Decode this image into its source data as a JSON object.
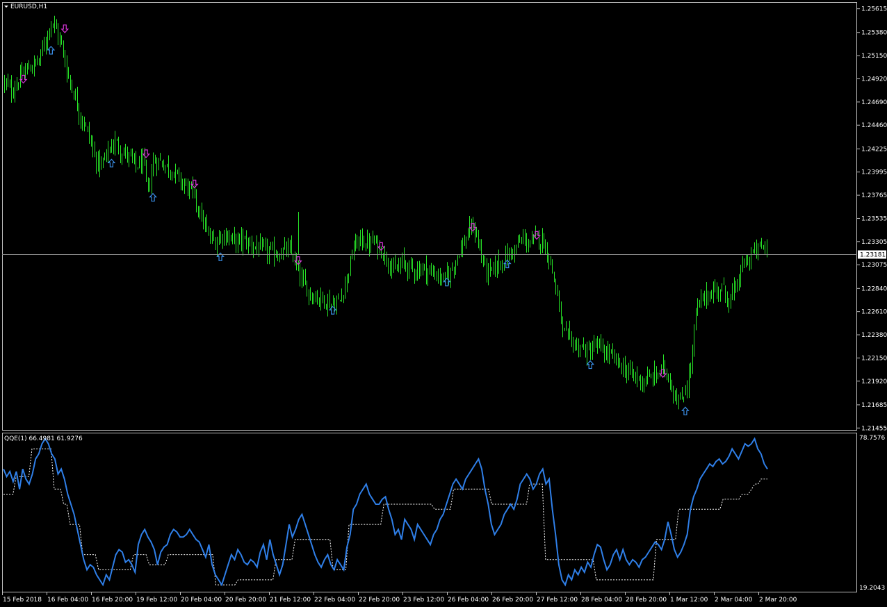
{
  "header": {
    "symbol_label": "EURUSD,H1"
  },
  "indicator": {
    "label": "QQE(1) 66.4981 61.9276"
  },
  "colors": {
    "background": "#000000",
    "frame": "#c0c0c0",
    "candle": "#27e327",
    "arrow_up": "#3a8ee6",
    "arrow_down": "#d633d6",
    "qqe_line": "#2f7fe8",
    "qqe_signal": "#ffffff",
    "price_line": "#8a8a8a",
    "price_badge": "#ffffff"
  },
  "chart_data": [
    {
      "type": "candlestick",
      "symbol": "EURUSD",
      "timeframe": "H1",
      "current_price": "1.23181",
      "y_ticks": [
        "1.25615",
        "1.25380",
        "1.25150",
        "1.24920",
        "1.24690",
        "1.24460",
        "1.24225",
        "1.23995",
        "1.23765",
        "1.23535",
        "1.23305",
        "1.23075",
        "1.22840",
        "1.22610",
        "1.22380",
        "1.22150",
        "1.21920",
        "1.21685",
        "1.21455"
      ],
      "x_ticks": [
        "15 Feb 2018",
        "16 Feb 04:00",
        "16 Feb 20:00",
        "19 Feb 12:00",
        "20 Feb 04:00",
        "20 Feb 20:00",
        "21 Feb 12:00",
        "22 Feb 04:00",
        "22 Feb 20:00",
        "23 Feb 12:00",
        "26 Feb 04:00",
        "26 Feb 20:00",
        "27 Feb 12:00",
        "28 Feb 04:00",
        "28 Feb 20:00",
        "1 Mar 12:00",
        "2 Mar 04:00",
        "2 Mar 20:00"
      ],
      "ylim": [
        1.2145,
        1.2564
      ],
      "close_path": [
        {
          "i": 0,
          "v": 1.2488
        },
        {
          "i": 4,
          "v": 1.248
        },
        {
          "i": 8,
          "v": 1.249
        },
        {
          "i": 12,
          "v": 1.25
        },
        {
          "i": 16,
          "v": 1.2505
        },
        {
          "i": 20,
          "v": 1.251
        },
        {
          "i": 24,
          "v": 1.2532
        },
        {
          "i": 27,
          "v": 1.255
        },
        {
          "i": 30,
          "v": 1.254
        },
        {
          "i": 33,
          "v": 1.2525
        },
        {
          "i": 36,
          "v": 1.25
        },
        {
          "i": 40,
          "v": 1.2478
        },
        {
          "i": 44,
          "v": 1.2455
        },
        {
          "i": 48,
          "v": 1.244
        },
        {
          "i": 52,
          "v": 1.2415
        },
        {
          "i": 56,
          "v": 1.2405
        },
        {
          "i": 60,
          "v": 1.242
        },
        {
          "i": 64,
          "v": 1.243
        },
        {
          "i": 68,
          "v": 1.242
        },
        {
          "i": 72,
          "v": 1.2415
        },
        {
          "i": 76,
          "v": 1.2405
        },
        {
          "i": 80,
          "v": 1.241
        },
        {
          "i": 83,
          "v": 1.238
        },
        {
          "i": 86,
          "v": 1.241
        },
        {
          "i": 90,
          "v": 1.241
        },
        {
          "i": 94,
          "v": 1.2405
        },
        {
          "i": 98,
          "v": 1.24
        },
        {
          "i": 102,
          "v": 1.239
        },
        {
          "i": 106,
          "v": 1.2385
        },
        {
          "i": 110,
          "v": 1.2375
        },
        {
          "i": 114,
          "v": 1.2355
        },
        {
          "i": 118,
          "v": 1.2335
        },
        {
          "i": 122,
          "v": 1.233
        },
        {
          "i": 126,
          "v": 1.2338
        },
        {
          "i": 130,
          "v": 1.2335
        },
        {
          "i": 134,
          "v": 1.233
        },
        {
          "i": 138,
          "v": 1.2332
        },
        {
          "i": 142,
          "v": 1.2328
        },
        {
          "i": 146,
          "v": 1.2325
        },
        {
          "i": 150,
          "v": 1.2322
        },
        {
          "i": 154,
          "v": 1.232
        },
        {
          "i": 158,
          "v": 1.2318
        },
        {
          "i": 162,
          "v": 1.2322
        },
        {
          "i": 166,
          "v": 1.232
        },
        {
          "i": 170,
          "v": 1.23
        },
        {
          "i": 174,
          "v": 1.2285
        },
        {
          "i": 178,
          "v": 1.2278
        },
        {
          "i": 182,
          "v": 1.2275
        },
        {
          "i": 186,
          "v": 1.2272
        },
        {
          "i": 190,
          "v": 1.2268
        },
        {
          "i": 194,
          "v": 1.2272
        },
        {
          "i": 198,
          "v": 1.2295
        },
        {
          "i": 202,
          "v": 1.2325
        },
        {
          "i": 206,
          "v": 1.2333
        },
        {
          "i": 210,
          "v": 1.2328
        },
        {
          "i": 214,
          "v": 1.233
        },
        {
          "i": 218,
          "v": 1.2322
        },
        {
          "i": 222,
          "v": 1.2312
        },
        {
          "i": 226,
          "v": 1.23
        },
        {
          "i": 230,
          "v": 1.231
        },
        {
          "i": 234,
          "v": 1.2305
        },
        {
          "i": 238,
          "v": 1.2302
        },
        {
          "i": 242,
          "v": 1.2305
        },
        {
          "i": 246,
          "v": 1.23
        },
        {
          "i": 250,
          "v": 1.2298
        },
        {
          "i": 254,
          "v": 1.2292
        },
        {
          "i": 258,
          "v": 1.23
        },
        {
          "i": 262,
          "v": 1.2318
        },
        {
          "i": 266,
          "v": 1.233
        },
        {
          "i": 270,
          "v": 1.2345
        },
        {
          "i": 273,
          "v": 1.2338
        },
        {
          "i": 276,
          "v": 1.2315
        },
        {
          "i": 280,
          "v": 1.2298
        },
        {
          "i": 284,
          "v": 1.2305
        },
        {
          "i": 288,
          "v": 1.2312
        },
        {
          "i": 292,
          "v": 1.2318
        },
        {
          "i": 296,
          "v": 1.2325
        },
        {
          "i": 300,
          "v": 1.2333
        },
        {
          "i": 304,
          "v": 1.2328
        },
        {
          "i": 308,
          "v": 1.2335
        },
        {
          "i": 312,
          "v": 1.233
        },
        {
          "i": 316,
          "v": 1.231
        },
        {
          "i": 320,
          "v": 1.2275
        },
        {
          "i": 323,
          "v": 1.224
        },
        {
          "i": 326,
          "v": 1.2235
        },
        {
          "i": 330,
          "v": 1.2228
        },
        {
          "i": 334,
          "v": 1.2225
        },
        {
          "i": 338,
          "v": 1.222
        },
        {
          "i": 342,
          "v": 1.2228
        },
        {
          "i": 346,
          "v": 1.2222
        },
        {
          "i": 350,
          "v": 1.2218
        },
        {
          "i": 354,
          "v": 1.2212
        },
        {
          "i": 358,
          "v": 1.2205
        },
        {
          "i": 362,
          "v": 1.22
        },
        {
          "i": 366,
          "v": 1.2195
        },
        {
          "i": 370,
          "v": 1.2192
        },
        {
          "i": 374,
          "v": 1.2195
        },
        {
          "i": 378,
          "v": 1.22
        },
        {
          "i": 382,
          "v": 1.2205
        },
        {
          "i": 385,
          "v": 1.2192
        },
        {
          "i": 388,
          "v": 1.2178
        },
        {
          "i": 391,
          "v": 1.217
        },
        {
          "i": 394,
          "v": 1.2185
        },
        {
          "i": 397,
          "v": 1.2205
        },
        {
          "i": 400,
          "v": 1.226
        },
        {
          "i": 403,
          "v": 1.2272
        },
        {
          "i": 407,
          "v": 1.2278
        },
        {
          "i": 411,
          "v": 1.2282
        },
        {
          "i": 415,
          "v": 1.2285
        },
        {
          "i": 419,
          "v": 1.2272
        },
        {
          "i": 423,
          "v": 1.2283
        },
        {
          "i": 427,
          "v": 1.2305
        },
        {
          "i": 431,
          "v": 1.2315
        },
        {
          "i": 435,
          "v": 1.2322
        },
        {
          "i": 439,
          "v": 1.2326
        },
        {
          "i": 441,
          "v": 1.2322
        }
      ],
      "bar_count": 442
    },
    {
      "type": "line",
      "name": "QQE(1)",
      "values_label": "66.4981 61.9276",
      "y_ticks": [
        "78.7576",
        "19.2043"
      ],
      "ylim": [
        19.2043,
        78.7576
      ],
      "series": [
        {
          "role": "qqe",
          "values": [
            66,
            63,
            65,
            61,
            65,
            58,
            66,
            62,
            60,
            64,
            70,
            72,
            76,
            78,
            76,
            72,
            70,
            64,
            66,
            62,
            56,
            52,
            48,
            42,
            36,
            30,
            26,
            28,
            27,
            24,
            22,
            20,
            24,
            22,
            27,
            32,
            34,
            33,
            29,
            30,
            28,
            25,
            36,
            40,
            42,
            39,
            37,
            34,
            28,
            33,
            35,
            36,
            40,
            42,
            41,
            39,
            39,
            40,
            42,
            40,
            38,
            37,
            34,
            31,
            36,
            28,
            24,
            22,
            20,
            24,
            28,
            32,
            30,
            34,
            32,
            29,
            28,
            30,
            29,
            27,
            33,
            36,
            30,
            38,
            32,
            28,
            24,
            28,
            36,
            44,
            39,
            42,
            46,
            48,
            44,
            40,
            36,
            32,
            29,
            27,
            30,
            32,
            28,
            26,
            30,
            28,
            26,
            35,
            40,
            50,
            52,
            56,
            58,
            60,
            56,
            54,
            52,
            52,
            54,
            55,
            50,
            46,
            40,
            42,
            38,
            46,
            44,
            42,
            38,
            44,
            42,
            40,
            38,
            36,
            40,
            42,
            46,
            48,
            52,
            56,
            60,
            62,
            60,
            58,
            62,
            64,
            66,
            68,
            70,
            66,
            58,
            52,
            44,
            40,
            42,
            44,
            48,
            50,
            52,
            50,
            54,
            60,
            62,
            64,
            62,
            58,
            60,
            64,
            66,
            60,
            62,
            50,
            40,
            28,
            22,
            20,
            24,
            22,
            26,
            24,
            27,
            25,
            29,
            27,
            32,
            36,
            35,
            30,
            26,
            28,
            32,
            34,
            30,
            34,
            30,
            28,
            30,
            29,
            27,
            30,
            31,
            33,
            35,
            37,
            36,
            34,
            38,
            45,
            40,
            34,
            31,
            33,
            36,
            40,
            50,
            55,
            58,
            62,
            64,
            66,
            68,
            67,
            69,
            70,
            68,
            69,
            71,
            74,
            72,
            70,
            73,
            76,
            75,
            76,
            78,
            74,
            72,
            68,
            66
          ]
        },
        {
          "role": "signal",
          "values": [
            56,
            56,
            56,
            56,
            63,
            63,
            63,
            63,
            63,
            74,
            74,
            74,
            74,
            74,
            74,
            74,
            58,
            58,
            58,
            52,
            52,
            44,
            44,
            44,
            44,
            32,
            32,
            32,
            32,
            32,
            26,
            26,
            26,
            26,
            26,
            26,
            26,
            26,
            26,
            26,
            26,
            32,
            32,
            32,
            32,
            32,
            28,
            28,
            28,
            28,
            28,
            28,
            32,
            32,
            32,
            32,
            32,
            32,
            32,
            32,
            32,
            32,
            32,
            32,
            32,
            32,
            32,
            20,
            20,
            20,
            20,
            20,
            20,
            20,
            22,
            22,
            22,
            22,
            22,
            22,
            22,
            22,
            22,
            22,
            22,
            22,
            30,
            30,
            30,
            30,
            30,
            30,
            38,
            38,
            38,
            38,
            38,
            38,
            38,
            38,
            38,
            38,
            38,
            38,
            26,
            26,
            26,
            26,
            26,
            44,
            44,
            44,
            44,
            44,
            44,
            44,
            44,
            44,
            44,
            44,
            52,
            52,
            52,
            52,
            52,
            52,
            52,
            52,
            52,
            52,
            52,
            52,
            52,
            52,
            52,
            52,
            50,
            50,
            50,
            50,
            50,
            50,
            58,
            58,
            58,
            58,
            58,
            58,
            58,
            58,
            58,
            58,
            58,
            58,
            52,
            52,
            52,
            52,
            52,
            52,
            52,
            52,
            52,
            52,
            52,
            52,
            60,
            60,
            60,
            60,
            60,
            30,
            30,
            30,
            30,
            30,
            30,
            30,
            30,
            30,
            30,
            30,
            30,
            30,
            30,
            30,
            30,
            22,
            22,
            22,
            22,
            22,
            22,
            22,
            22,
            22,
            22,
            22,
            22,
            22,
            22,
            22,
            22,
            22,
            22,
            22,
            38,
            38,
            38,
            38,
            38,
            38,
            38,
            50,
            50,
            50,
            50,
            50,
            50,
            50,
            50,
            50,
            50,
            50,
            50,
            50,
            50,
            54,
            54,
            54,
            54,
            54,
            54,
            56,
            56,
            56,
            58,
            60,
            60,
            62,
            62,
            62
          ]
        }
      ]
    }
  ]
}
